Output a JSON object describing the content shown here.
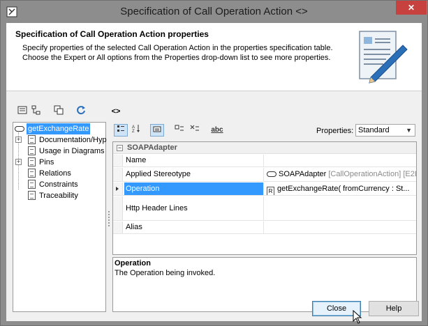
{
  "window": {
    "title": "Specification of Call Operation Action <>",
    "close_glyph": "✕"
  },
  "header": {
    "title": "Specification of Call Operation Action properties",
    "desc_line1": "Specify properties of the selected Call Operation Action in the properties specification table.",
    "desc_line2": "Choose the Expert or All options from the Properties drop-down list to see more properties."
  },
  "toolbar": {
    "back_forward_label": "<>"
  },
  "tree": {
    "root": "getExchangeRate",
    "items": [
      {
        "label": "Documentation/Hyp",
        "expandable": true
      },
      {
        "label": "Usage in Diagrams",
        "expandable": false
      },
      {
        "label": "Pins",
        "expandable": true
      },
      {
        "label": "Relations",
        "expandable": false
      },
      {
        "label": "Constraints",
        "expandable": false
      },
      {
        "label": "Traceability",
        "expandable": false
      }
    ],
    "expander_glyph": "+"
  },
  "properties_toolbar": {
    "abc_label": "abc",
    "properties_label": "Properties:",
    "properties_value": "Standard"
  },
  "grid": {
    "group": "SOAPAdapter",
    "rows": [
      {
        "name": "Name",
        "value": ""
      },
      {
        "name": "Applied Stereotype",
        "value": "SOAPAdapter",
        "value_extra": " [CallOperationAction] [E2E"
      },
      {
        "name": "Operation",
        "value": "getExchangeRate( fromCurrency : St..."
      },
      {
        "name": "Http Header Lines",
        "value": ""
      },
      {
        "name": "Alias",
        "value": ""
      }
    ]
  },
  "description": {
    "title": "Operation",
    "text": "The Operation being invoked."
  },
  "buttons": {
    "close": "Close",
    "help": "Help"
  },
  "colors": {
    "selection": "#3399ff",
    "title_bar": "#8d8d8d",
    "close_button": "#c7413e"
  }
}
